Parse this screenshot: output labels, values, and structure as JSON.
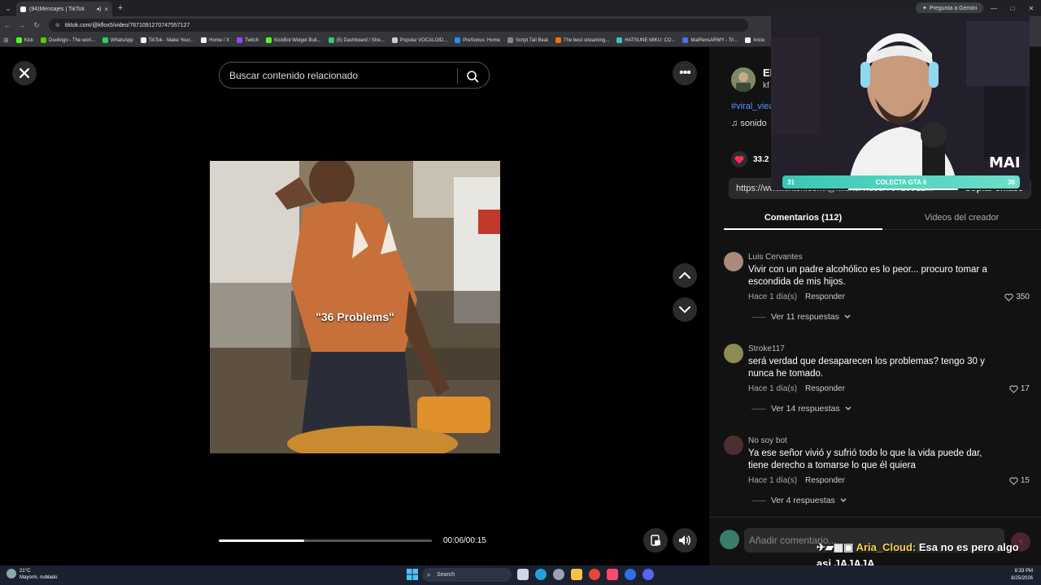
{
  "browser": {
    "tab_title": "(94)Mensajes | TikTok",
    "url": "tiktok.com/@kflox5/video/7671091270747557127",
    "gemini_label": "Pregunta a Gemini",
    "bookmarks": [
      {
        "label": "Kick",
        "color": "#53fc18"
      },
      {
        "label": "Duolingo - The worl...",
        "color": "#58cc02"
      },
      {
        "label": "WhatsApp",
        "color": "#25d366"
      },
      {
        "label": "TikTok - Make Your...",
        "color": "#ffffff"
      },
      {
        "label": "Home / X",
        "color": "#ffffff"
      },
      {
        "label": "Twitch",
        "color": "#9146ff"
      },
      {
        "label": "KickBot Widget Buil...",
        "color": "#53fc18"
      },
      {
        "label": "(5) Dashboard / Stre...",
        "color": "#2ecc71"
      },
      {
        "label": "Popular VOCALOID...",
        "color": "#cccccc"
      },
      {
        "label": "PreSonus: Home",
        "color": "#1e90ff"
      },
      {
        "label": "Script Tail Beat",
        "color": "#888888"
      },
      {
        "label": "The best streaming...",
        "color": "#ff6b00"
      },
      {
        "label": "HATSUNE MIKU: CO...",
        "color": "#39c5bb"
      },
      {
        "label": "MaiRensARMY - Tri...",
        "color": "#4a6cf7"
      },
      {
        "label": "Inicio",
        "color": "#ffffff"
      }
    ]
  },
  "video": {
    "search_placeholder": "Buscar contenido relacionado",
    "caption": "\"36 Problems\"",
    "time": "00:06/00:15",
    "progress": 0.4
  },
  "side": {
    "author_name": "El",
    "author_id": "kf",
    "hashtag": "#viral_viea",
    "sound": "sonido",
    "likes": "33.2",
    "link": "https://www.tiktok.com/@kflox5/video/76710912...",
    "copy_label": "Copiar enlace",
    "tab_comments": "Comentarios (112)",
    "tab_videos": "Videos del creador",
    "comments": [
      {
        "user": "Luis Cervantes",
        "text": "Vivir con un padre alcohólico es lo peor... procuro tomar a escondida de mis hijos.",
        "time": "Hace 1 día(s)",
        "reply": "Responder",
        "likes": "350",
        "replies": "Ver 11 respuestas",
        "avatar_color": "#a88b7a"
      },
      {
        "user": "Stroke117",
        "text": "será verdad que desaparecen los problemas? tengo 30 y nunca he tomado.",
        "time": "Hace 1 día(s)",
        "reply": "Responder",
        "likes": "17",
        "replies": "Ver 14 respuestas",
        "avatar_color": "#8c8a55"
      },
      {
        "user": "No soy bot",
        "text": "Ya ese señor vivió y sufrió todo lo que la vida puede dar, tiene derecho a tomarse lo que él quiera",
        "time": "Hace 1 día(s)",
        "reply": "Responder",
        "likes": "15",
        "replies": "Ver 4 respuestas",
        "avatar_color": "#4a3030"
      }
    ],
    "add_comment_placeholder": "Añadir comentario..."
  },
  "stream": {
    "collect_left": "31",
    "collect_label": "COLECTA GTA 6",
    "collect_right": "30",
    "mai": "MAI",
    "chat_user": "Aria_Cloud:",
    "chat_text": "Esa no es pero algo asi JAJAJA"
  },
  "taskbar": {
    "temp": "21°C",
    "weather": "Mayorm. nublado",
    "search": "Search",
    "time": "8:33 PM",
    "date": "8/25/2026"
  },
  "colors": {
    "accent": "#fe2c55",
    "link": "#5f8fff",
    "page_bg": "#000000",
    "panel_bg": "#121212"
  }
}
